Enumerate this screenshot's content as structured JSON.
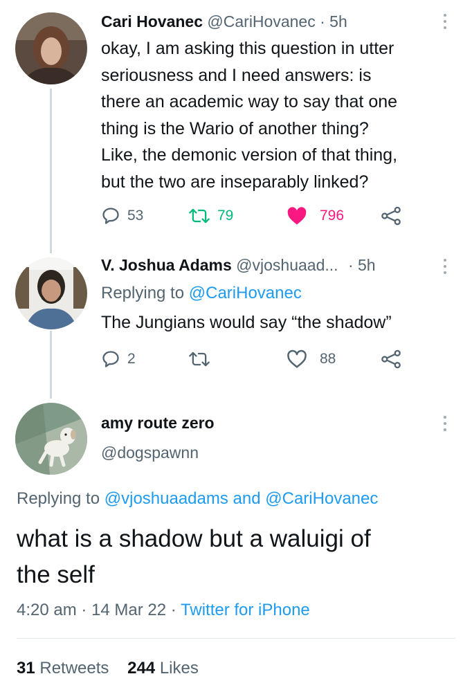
{
  "tweets": [
    {
      "name": "Cari Hovanec",
      "handle": "@CariHovanec",
      "separator": "·",
      "time": "5h",
      "text_lines": [
        "okay, I am asking this question in utter",
        "seriousness and I need answers: is",
        "there an academic way to say that one",
        "thing is the Wario of another thing?",
        "Like, the demonic version of that thing,",
        "but the two are inseparably linked?"
      ],
      "replies": "53",
      "retweets": "79",
      "likes": "796",
      "liked": true,
      "colors": {
        "retweet": "#00ba7c",
        "like": "#f91880"
      }
    },
    {
      "name": "V. Joshua Adams",
      "handle": "@vjoshuaad...",
      "separator": "·",
      "time": "5h",
      "replying_label": "Replying to",
      "replying_to": "@CariHovanec",
      "text": "The Jungians would say “the shadow”",
      "replies": "2",
      "retweets": "",
      "likes": "88",
      "liked": false
    }
  ],
  "main_tweet": {
    "name": "amy route zero",
    "handle": "@dogspawnn",
    "replying_label": "Replying to",
    "replying_to_1": "@vjoshuaadams",
    "replying_and": "and",
    "replying_to_2": "@CariHovanec",
    "text_lines": [
      "what is a shadow but a waluigi of",
      "the self"
    ],
    "time": "4:20 am",
    "date": "14 Mar 22",
    "separator": "·",
    "source": "Twitter for iPhone",
    "retweets_count": "31",
    "retweets_label": "Retweets",
    "likes_count": "244",
    "likes_label": "Likes"
  },
  "icons": [
    "reply-icon",
    "retweet-icon",
    "heart-icon",
    "share-icon",
    "more-icon"
  ],
  "colors": {
    "link": "#1d9bf0",
    "muted": "#536471",
    "text": "#0f1419",
    "divider": "#eff3f4"
  }
}
